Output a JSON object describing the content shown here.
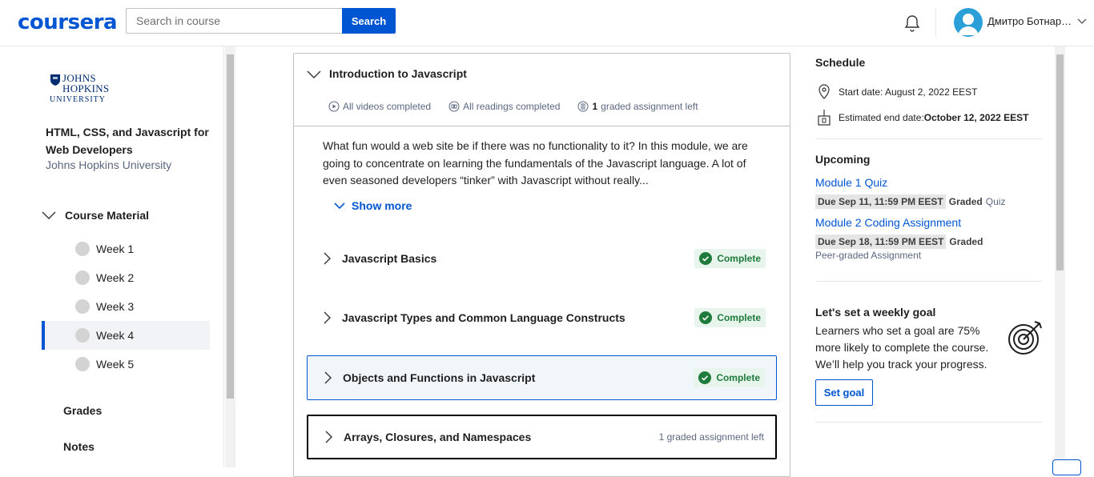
{
  "header": {
    "logo": "coursera",
    "search_placeholder": "Search in course",
    "search_button": "Search",
    "user_name": "Дмитро Ботнаре..."
  },
  "sidebar": {
    "university_logo": [
      "JOHNS",
      "HOPKINS",
      "UNIVERSITY"
    ],
    "course_title": "HTML, CSS, and Javascript for Web Developers",
    "course_org": "Johns Hopkins University",
    "course_material_label": "Course Material",
    "weeks": [
      {
        "label": "Week 1"
      },
      {
        "label": "Week 2"
      },
      {
        "label": "Week 3"
      },
      {
        "label": "Week 4"
      },
      {
        "label": "Week 5"
      }
    ],
    "grades_label": "Grades",
    "notes_label": "Notes"
  },
  "module": {
    "title": "Introduction to Javascript",
    "stats": {
      "videos": "All videos completed",
      "readings": "All readings completed",
      "graded_count": "1",
      "graded_label": "graded assignment left"
    },
    "description": "What fun would a web site be if there was no functionality to it? In this module, we are going to concentrate on learning the fundamentals of the Javascript language. A lot of even seasoned developers “tinker” with Javascript without really...",
    "show_more": "Show more",
    "lessons": [
      {
        "title": "Javascript Basics",
        "status": "Complete"
      },
      {
        "title": "Javascript Types and Common Language Constructs",
        "status": "Complete"
      },
      {
        "title": "Objects and Functions in Javascript",
        "status": "Complete"
      },
      {
        "title": "Arrays, Closures, and Namespaces",
        "status": "1 graded assignment left"
      }
    ]
  },
  "schedule": {
    "heading": "Schedule",
    "start_date": "Start date: August 2, 2022 EEST",
    "end_label": "Estimated end date: ",
    "end_value": "October 12, 2022 EEST"
  },
  "upcoming": {
    "heading": "Upcoming",
    "items": [
      {
        "title": "Module 1 Quiz",
        "due": "Due Sep 11, 11:59 PM EEST",
        "graded": "Graded",
        "kind": "Quiz"
      },
      {
        "title": "Module 2 Coding Assignment",
        "due": "Due Sep 18, 11:59 PM EEST",
        "graded": "Graded",
        "kind": "Peer-graded Assignment"
      }
    ]
  },
  "goal": {
    "heading": "Let's set a weekly goal",
    "text": "Learners who set a goal are 75% more likely to complete the course. We’ll help you track your progress.",
    "button": "Set goal"
  },
  "colors": {
    "brand": "#0056d2",
    "complete_green": "#1e7b3b"
  }
}
